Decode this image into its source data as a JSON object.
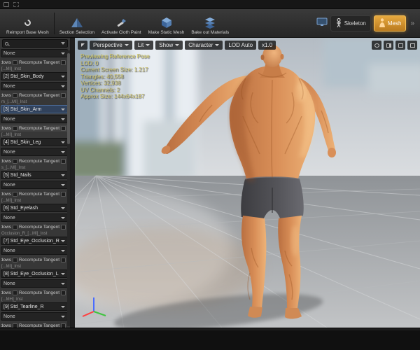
{
  "top_toolbar": {
    "buttons": [
      {
        "label": "Reimport Base Mesh",
        "icon": "reimport-arrow"
      },
      {
        "label": "Section Selection",
        "icon": "pyramid"
      },
      {
        "label": "Activate Cloth Paint",
        "icon": "paint-brush"
      },
      {
        "label": "Make Static Mesh",
        "icon": "cube"
      },
      {
        "label": "Bake out Materials",
        "icon": "layer-stack"
      }
    ],
    "asset_tabs": [
      {
        "label": "Skeleton",
        "icon": "skeleton-figure",
        "active": false
      },
      {
        "label": "Mesh",
        "icon": "character-figure",
        "active": true
      }
    ],
    "overflow": "»"
  },
  "left_panel": {
    "search": {
      "placeholder": ""
    },
    "shadows_label": "Shadows",
    "recompute_label": "Recompute Tangent",
    "partial_top": {
      "element_value": "None"
    },
    "material_groups": [
      {
        "header": "[...MI]_Inst",
        "slot": "[2] Std_Skin_Body",
        "element_value": "None",
        "selected": false
      },
      {
        "header": "m_[...MI]_Inst",
        "slot": "[3] Std_Skin_Arm",
        "element_value": "None",
        "selected": true
      },
      {
        "header": "[...MI]_Inst",
        "slot": "[4] Std_Skin_Leg",
        "element_value": "None",
        "selected": false
      },
      {
        "header": "s_[...MI]_Inst",
        "slot": "[5] Std_Nails",
        "element_value": "None",
        "selected": false
      },
      {
        "header": "[...MI]_Inst",
        "slot": "[6] Std_Eyelash",
        "element_value": "None",
        "selected": false
      },
      {
        "header": "Occlusion_R_[...MI]_Inst",
        "slot": "[7] Std_Eye_Occlusion_R",
        "element_value": "None",
        "selected": false
      },
      {
        "header": "[...MI]_Inst",
        "slot": "[8] Std_Eye_Occlusion_L",
        "element_value": "None",
        "selected": false
      },
      {
        "header": "[...MH]_Inst",
        "slot": "[9] Std_Tearline_R",
        "element_value": "None",
        "selected": false
      }
    ]
  },
  "viewport": {
    "toolbar": [
      {
        "label": "Perspective",
        "caret": true
      },
      {
        "label": "Lit",
        "caret": true
      },
      {
        "label": "Show",
        "caret": true
      },
      {
        "label": "Character",
        "caret": true
      },
      {
        "label": "LOD Auto",
        "caret": false
      },
      {
        "label": "x1.0",
        "caret": false
      }
    ],
    "stats": [
      "Previewing Reference Pose",
      "LOD: 0",
      "Current Screen Size: 1.217",
      "Triangles: 40,558",
      "Vertices: 32,938",
      "UV Channels: 2",
      "Approx Size: 144x64x187"
    ]
  },
  "colors": {
    "accent_orange": "#d2912f",
    "icon_blue": "#5580b4",
    "stats_text": "#cfc36a",
    "skin_mid": "#d98f58",
    "shorts_gray": "#55555a"
  }
}
